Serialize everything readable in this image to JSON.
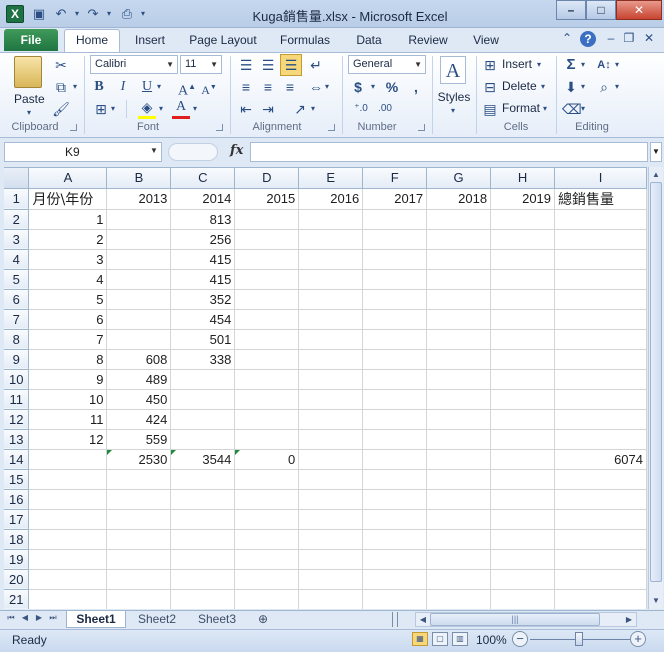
{
  "window": {
    "title": "Kuga銷售量.xlsx  -  Microsoft Excel",
    "min_label": "–",
    "max_label": "□",
    "close_label": "✕"
  },
  "ribbon": {
    "tabs": [
      "File",
      "Home",
      "Insert",
      "Page Layout",
      "Formulas",
      "Data",
      "Review",
      "View"
    ],
    "clipboard": {
      "paste": "Paste",
      "group": "Clipboard"
    },
    "font": {
      "name": "Calibri",
      "size": "11",
      "group": "Font"
    },
    "alignment": {
      "group": "Alignment"
    },
    "number": {
      "format": "General",
      "currency": "$",
      "percent": "%",
      "comma": ",",
      "group": "Number"
    },
    "styles": {
      "label": "Styles"
    },
    "cells": {
      "insert": "Insert",
      "delete": "Delete",
      "format": "Format",
      "group": "Cells"
    },
    "editing": {
      "group": "Editing",
      "sum": "Σ"
    }
  },
  "formula_bar": {
    "name_box": "K9",
    "fx": "fx",
    "content": ""
  },
  "sheet": {
    "columns": [
      "A",
      "B",
      "C",
      "D",
      "E",
      "F",
      "G",
      "H",
      "I"
    ],
    "row_numbers": [
      "1",
      "2",
      "3",
      "4",
      "5",
      "6",
      "7",
      "8",
      "9",
      "10",
      "11",
      "12",
      "13",
      "14",
      "15",
      "16",
      "17",
      "18",
      "19",
      "20",
      "21"
    ],
    "rows": [
      [
        "月份\\年份",
        "2013",
        "2014",
        "2015",
        "2016",
        "2017",
        "2018",
        "2019",
        "總銷售量"
      ],
      [
        "1",
        "",
        "813",
        "",
        "",
        "",
        "",
        "",
        ""
      ],
      [
        "2",
        "",
        "256",
        "",
        "",
        "",
        "",
        "",
        ""
      ],
      [
        "3",
        "",
        "415",
        "",
        "",
        "",
        "",
        "",
        ""
      ],
      [
        "4",
        "",
        "415",
        "",
        "",
        "",
        "",
        "",
        ""
      ],
      [
        "5",
        "",
        "352",
        "",
        "",
        "",
        "",
        "",
        ""
      ],
      [
        "6",
        "",
        "454",
        "",
        "",
        "",
        "",
        "",
        ""
      ],
      [
        "7",
        "",
        "501",
        "",
        "",
        "",
        "",
        "",
        ""
      ],
      [
        "8",
        "608",
        "338",
        "",
        "",
        "",
        "",
        "",
        ""
      ],
      [
        "9",
        "489",
        "",
        "",
        "",
        "",
        "",
        "",
        ""
      ],
      [
        "10",
        "450",
        "",
        "",
        "",
        "",
        "",
        "",
        ""
      ],
      [
        "11",
        "424",
        "",
        "",
        "",
        "",
        "",
        "",
        ""
      ],
      [
        "12",
        "559",
        "",
        "",
        "",
        "",
        "",
        "",
        ""
      ],
      [
        "",
        "2530",
        "3544",
        "0",
        "",
        "",
        "",
        "",
        "6074"
      ],
      [
        "",
        "",
        "",
        "",
        "",
        "",
        "",
        "",
        ""
      ],
      [
        "",
        "",
        "",
        "",
        "",
        "",
        "",
        "",
        ""
      ],
      [
        "",
        "",
        "",
        "",
        "",
        "",
        "",
        "",
        ""
      ],
      [
        "",
        "",
        "",
        "",
        "",
        "",
        "",
        "",
        ""
      ],
      [
        "",
        "",
        "",
        "",
        "",
        "",
        "",
        "",
        ""
      ],
      [
        "",
        "",
        "",
        "",
        "",
        "",
        "",
        "",
        ""
      ],
      [
        "",
        "",
        "",
        "",
        "",
        "",
        "",
        "",
        ""
      ]
    ]
  },
  "sheet_tabs": [
    "Sheet1",
    "Sheet2",
    "Sheet3"
  ],
  "status": {
    "text": "Ready",
    "zoom": "100%"
  }
}
